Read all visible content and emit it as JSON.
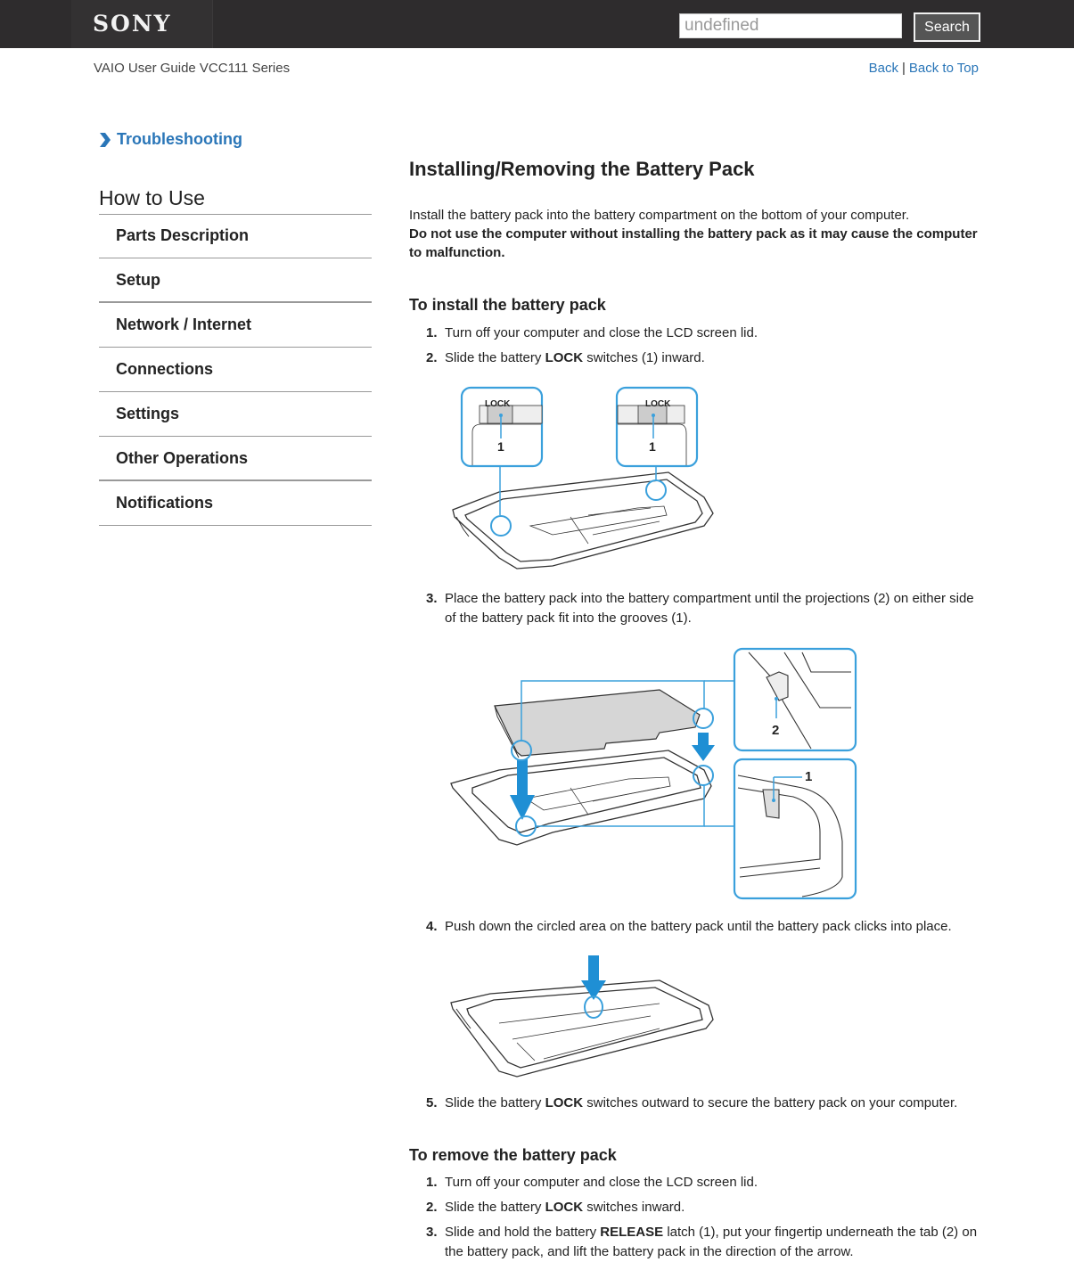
{
  "header": {
    "logo": "SONY",
    "search": {
      "value": "",
      "placeholder": "undefined",
      "button_label": "Search"
    },
    "guide_title": "VAIO User Guide VCC111 Series",
    "links": {
      "back": "Back",
      "separator": "|",
      "back_to_top": "Back to Top"
    }
  },
  "sidebar": {
    "troubleshooting": "Troubleshooting",
    "section_title": "How to Use",
    "items": [
      {
        "label": "Parts Description"
      },
      {
        "label": "Setup"
      },
      {
        "label": "Network / Internet"
      },
      {
        "label": "Connections"
      },
      {
        "label": "Settings"
      },
      {
        "label": "Other Operations"
      },
      {
        "label": "Notifications"
      }
    ]
  },
  "main": {
    "title": "Installing/Removing the Battery Pack",
    "intro": "Install the battery pack into the battery compartment on the bottom of your computer.",
    "warning": "Do not use the computer without installing the battery pack as it may cause the computer to malfunction.",
    "install": {
      "heading": "To install the battery pack",
      "steps": [
        {
          "num": "1.",
          "text": "Turn off your computer and close the LCD screen lid."
        },
        {
          "num": "2.",
          "pre": "Slide the battery ",
          "bold": "LOCK",
          "post": " switches (1) inward."
        },
        {
          "num": "3.",
          "text": "Place the battery pack into the battery compartment until the projections (2) on either side of the battery pack fit into the grooves (1)."
        },
        {
          "num": "4.",
          "text": "Push down the circled area on the battery pack until the battery pack clicks into place."
        },
        {
          "num": "5.",
          "pre": "Slide the battery ",
          "bold": "LOCK",
          "post": " switches outward to secure the battery pack on your computer."
        }
      ]
    },
    "remove": {
      "heading": "To remove the battery pack",
      "steps": [
        {
          "num": "1.",
          "text": "Turn off your computer and close the LCD screen lid."
        },
        {
          "num": "2.",
          "pre": "Slide the battery ",
          "bold": "LOCK",
          "post": " switches inward."
        },
        {
          "num": "3.",
          "pre": "Slide and hold the battery ",
          "bold": "RELEASE",
          "post": " latch (1), put your fingertip underneath the tab (2) on the battery pack, and lift the battery pack in the direction of the arrow."
        }
      ]
    },
    "illustrations": {
      "lock": {
        "label_lock": "LOCK",
        "callout": "1"
      },
      "place": {
        "callout_projection": "2",
        "callout_groove": "1"
      }
    }
  },
  "colors": {
    "accent": "#2a76b8",
    "callout": "#3aa0dc",
    "topbar": "#2e2c2d"
  }
}
